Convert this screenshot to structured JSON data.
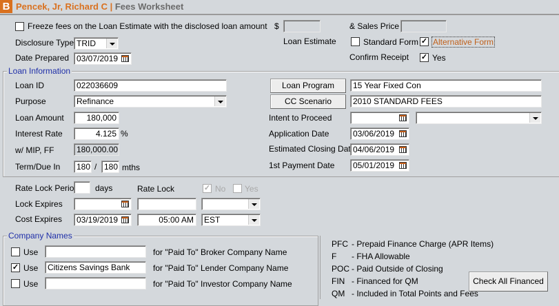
{
  "header": {
    "icon_letter": "B",
    "borrower": "Pencek, Jr, Richard C",
    "separator": " | ",
    "title": "Fees Worksheet"
  },
  "top": {
    "freeze_label": "Freeze fees on the Loan Estimate with the disclosed loan amount",
    "freeze_checked": false,
    "dollar_label": "$",
    "loan_estimate_amount": "",
    "loan_estimate_label": "Loan Estimate",
    "sales_price_label": "& Sales Price $",
    "sales_price": "",
    "disclosure_type_label": "Disclosure Type",
    "disclosure_type": "TRID",
    "date_prepared_label": "Date Prepared",
    "date_prepared": "03/07/2019",
    "standard_form_label": "Standard Form",
    "standard_form_checked": false,
    "alternative_form_label": "Alternative Form",
    "alternative_form_checked": true,
    "confirm_receipt_label": "Confirm Receipt",
    "confirm_yes_label": "Yes",
    "confirm_checked": true
  },
  "loan_info": {
    "group_label": "Loan Information",
    "loan_id_label": "Loan ID",
    "loan_id": "022036609",
    "purpose_label": "Purpose",
    "purpose": "Refinance",
    "loan_amount_label": "Loan Amount",
    "loan_amount": "180,000",
    "interest_rate_label": "Interest Rate",
    "interest_rate": "4.125",
    "percent": "%",
    "mip_label": "w/ MIP, FF",
    "mip": "180,000.00",
    "term_label": "Term/Due In",
    "term": "180",
    "slash": "/",
    "due": "180",
    "mths": "mths",
    "loan_program_button": "Loan Program",
    "loan_program": "15 Year Fixed Con",
    "cc_scenario_button": "CC Scenario",
    "cc_scenario": "2010 STANDARD FEES",
    "intent_label": "Intent to Proceed",
    "intent_date": "",
    "intent_select": "",
    "application_date_label": "Application Date",
    "application_date": "03/06/2019",
    "closing_date_label": "Estimated Closing Date",
    "closing_date": "04/06/2019",
    "first_payment_label": "1st Payment Date",
    "first_payment": "05/01/2019"
  },
  "rate_lock": {
    "period_label": "Rate Lock Period",
    "period": "",
    "days": "days",
    "rate_lock_label": "Rate Lock",
    "no_label": "No",
    "no_checked": true,
    "yes_label": "Yes",
    "yes_checked": false,
    "lock_expires_label": "Lock Expires",
    "lock_expires_date": "",
    "lock_expires_time": "",
    "lock_expires_tz": "",
    "cost_expires_label": "Cost Expires",
    "cost_expires_date": "03/19/2019",
    "cost_expires_time": "05:00 AM",
    "cost_expires_tz": "EST"
  },
  "company": {
    "group_label": "Company Names",
    "rows": [
      {
        "use": "Use",
        "checked": false,
        "name": "",
        "desc": "for \"Paid To\" Broker Company Name"
      },
      {
        "use": "Use",
        "checked": true,
        "name": "Citizens Savings Bank",
        "desc": "for \"Paid To\" Lender Company Name"
      },
      {
        "use": "Use",
        "checked": false,
        "name": "",
        "desc": "for \"Paid To\" Investor Company Name"
      }
    ]
  },
  "legend": [
    {
      "code": "PFC",
      "text": "- Prepaid Finance Charge (APR Items)"
    },
    {
      "code": "F",
      "text": "- FHA Allowable"
    },
    {
      "code": "POC",
      "text": "- Paid Outside of Closing"
    },
    {
      "code": "FIN",
      "text": "- Financed for QM"
    },
    {
      "code": "QM",
      "text": "- Included in Total Points and Fees"
    }
  ],
  "check_all_financed": "Check All Financed",
  "colors": {
    "brand": "#d9711f",
    "group_label": "#1f2fa8",
    "background": "#d4d8dc"
  }
}
